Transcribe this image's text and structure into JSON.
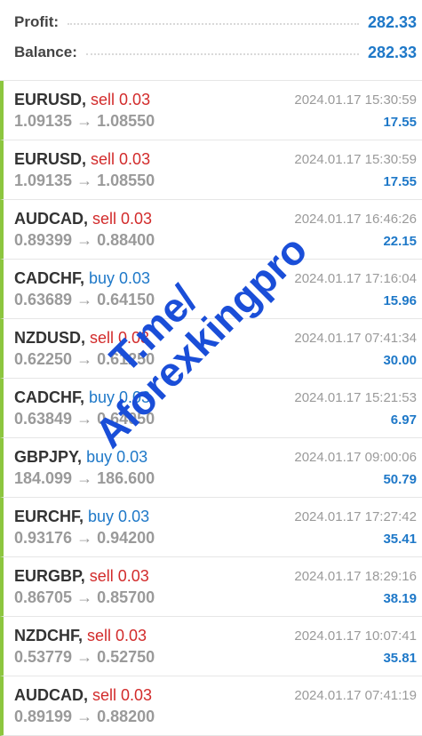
{
  "summary": {
    "profit_label": "Profit:",
    "profit_value": "282.33",
    "balance_label": "Balance:",
    "balance_value": "282.33"
  },
  "trades": [
    {
      "symbol": "EURUSD,",
      "side": "sell 0.03",
      "prices": "1.09135 → 1.08550",
      "time": "2024.01.17 15:30:59",
      "profit": "17.55"
    },
    {
      "symbol": "EURUSD,",
      "side": "sell 0.03",
      "prices": "1.09135 → 1.08550",
      "time": "2024.01.17 15:30:59",
      "profit": "17.55"
    },
    {
      "symbol": "AUDCAD,",
      "side": "sell 0.03",
      "prices": "0.89399 → 0.88400",
      "time": "2024.01.17 16:46:26",
      "profit": "22.15"
    },
    {
      "symbol": "CADCHF,",
      "side": "buy 0.03",
      "prices": "0.63689 → 0.64150",
      "time": "2024.01.17 17:16:04",
      "profit": "15.96"
    },
    {
      "symbol": "NZDUSD,",
      "side": "sell 0.03",
      "prices": "0.62250 → 0.61250",
      "time": "2024.01.17 07:41:34",
      "profit": "30.00"
    },
    {
      "symbol": "CADCHF,",
      "side": "buy 0.03",
      "prices": "0.63849 → 0.64050",
      "time": "2024.01.17 15:21:53",
      "profit": "6.97"
    },
    {
      "symbol": "GBPJPY,",
      "side": "buy 0.03",
      "prices": "184.099 → 186.600",
      "time": "2024.01.17 09:00:06",
      "profit": "50.79"
    },
    {
      "symbol": "EURCHF,",
      "side": "buy 0.03",
      "prices": "0.93176 → 0.94200",
      "time": "2024.01.17 17:27:42",
      "profit": "35.41"
    },
    {
      "symbol": "EURGBP,",
      "side": "sell 0.03",
      "prices": "0.86705 → 0.85700",
      "time": "2024.01.17 18:29:16",
      "profit": "38.19"
    },
    {
      "symbol": "NZDCHF,",
      "side": "sell 0.03",
      "prices": "0.53779 → 0.52750",
      "time": "2024.01.17 10:07:41",
      "profit": "35.81"
    },
    {
      "symbol": "AUDCAD,",
      "side": "sell 0.03",
      "prices": "0.89199 → 0.88200",
      "time": "2024.01.17 07:41:19",
      "profit": ""
    }
  ],
  "watermark": {
    "line1": "T.me/",
    "line2": "Aforexkingpro"
  }
}
